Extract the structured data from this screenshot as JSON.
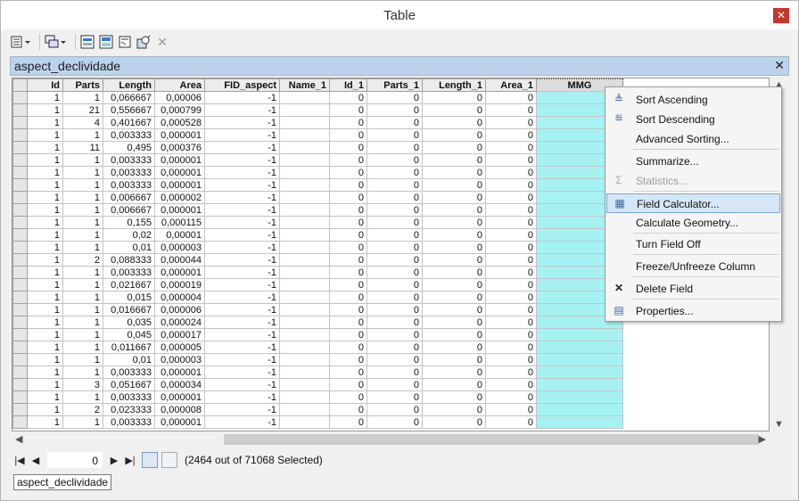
{
  "window": {
    "title": "Table",
    "close_glyph": "✕"
  },
  "toolbar": {
    "icons": [
      "table-options-icon",
      "related-tables-icon",
      "select-by-attributes-icon",
      "switch-selection-icon",
      "clear-selection-icon",
      "zoom-to-selected-icon",
      "delete-selected-icon"
    ]
  },
  "tab": {
    "title": "aspect_declividade",
    "close_glyph": "✕"
  },
  "grid": {
    "columns": [
      "Id",
      "Parts",
      "Length",
      "Area",
      "FID_aspect",
      "Name_1",
      "Id_1",
      "Parts_1",
      "Length_1",
      "Area_1",
      "MMG"
    ],
    "rows": [
      [
        "1",
        "1",
        "0,066667",
        "0,00006",
        "-1",
        "",
        "0",
        "0",
        "0",
        "0",
        ""
      ],
      [
        "1",
        "21",
        "0,556667",
        "0,000799",
        "-1",
        "",
        "0",
        "0",
        "0",
        "0",
        ""
      ],
      [
        "1",
        "4",
        "0,401667",
        "0,000528",
        "-1",
        "",
        "0",
        "0",
        "0",
        "0",
        ""
      ],
      [
        "1",
        "1",
        "0,003333",
        "0,000001",
        "-1",
        "",
        "0",
        "0",
        "0",
        "0",
        ""
      ],
      [
        "1",
        "11",
        "0,495",
        "0,000376",
        "-1",
        "",
        "0",
        "0",
        "0",
        "0",
        ""
      ],
      [
        "1",
        "1",
        "0,003333",
        "0,000001",
        "-1",
        "",
        "0",
        "0",
        "0",
        "0",
        ""
      ],
      [
        "1",
        "1",
        "0,003333",
        "0,000001",
        "-1",
        "",
        "0",
        "0",
        "0",
        "0",
        ""
      ],
      [
        "1",
        "1",
        "0,003333",
        "0,000001",
        "-1",
        "",
        "0",
        "0",
        "0",
        "0",
        ""
      ],
      [
        "1",
        "1",
        "0,006667",
        "0,000002",
        "-1",
        "",
        "0",
        "0",
        "0",
        "0",
        ""
      ],
      [
        "1",
        "1",
        "0,006667",
        "0,000001",
        "-1",
        "",
        "0",
        "0",
        "0",
        "0",
        ""
      ],
      [
        "1",
        "1",
        "0,155",
        "0,000115",
        "-1",
        "",
        "0",
        "0",
        "0",
        "0",
        ""
      ],
      [
        "1",
        "1",
        "0,02",
        "0,00001",
        "-1",
        "",
        "0",
        "0",
        "0",
        "0",
        ""
      ],
      [
        "1",
        "1",
        "0,01",
        "0,000003",
        "-1",
        "",
        "0",
        "0",
        "0",
        "0",
        ""
      ],
      [
        "1",
        "2",
        "0,088333",
        "0,000044",
        "-1",
        "",
        "0",
        "0",
        "0",
        "0",
        ""
      ],
      [
        "1",
        "1",
        "0,003333",
        "0,000001",
        "-1",
        "",
        "0",
        "0",
        "0",
        "0",
        ""
      ],
      [
        "1",
        "1",
        "0,021667",
        "0,000019",
        "-1",
        "",
        "0",
        "0",
        "0",
        "0",
        ""
      ],
      [
        "1",
        "1",
        "0,015",
        "0,000004",
        "-1",
        "",
        "0",
        "0",
        "0",
        "0",
        ""
      ],
      [
        "1",
        "1",
        "0,016667",
        "0,000006",
        "-1",
        "",
        "0",
        "0",
        "0",
        "0",
        ""
      ],
      [
        "1",
        "1",
        "0,035",
        "0,000024",
        "-1",
        "",
        "0",
        "0",
        "0",
        "0",
        ""
      ],
      [
        "1",
        "1",
        "0,045",
        "0,000017",
        "-1",
        "",
        "0",
        "0",
        "0",
        "0",
        ""
      ],
      [
        "1",
        "1",
        "0,011667",
        "0,000005",
        "-1",
        "",
        "0",
        "0",
        "0",
        "0",
        ""
      ],
      [
        "1",
        "1",
        "0,01",
        "0,000003",
        "-1",
        "",
        "0",
        "0",
        "0",
        "0",
        ""
      ],
      [
        "1",
        "1",
        "0,003333",
        "0,000001",
        "-1",
        "",
        "0",
        "0",
        "0",
        "0",
        ""
      ],
      [
        "1",
        "3",
        "0,051667",
        "0,000034",
        "-1",
        "",
        "0",
        "0",
        "0",
        "0",
        ""
      ],
      [
        "1",
        "1",
        "0,003333",
        "0,000001",
        "-1",
        "",
        "0",
        "0",
        "0",
        "0",
        ""
      ],
      [
        "1",
        "2",
        "0,023333",
        "0,000008",
        "-1",
        "",
        "0",
        "0",
        "0",
        "0",
        ""
      ],
      [
        "1",
        "1",
        "0,003333",
        "0,000001",
        "-1",
        "",
        "0",
        "0",
        "0",
        "0",
        ""
      ]
    ],
    "mmg_color": "#a6f2f2"
  },
  "context_menu": {
    "items": [
      {
        "label": "Sort Ascending",
        "icon": "sort-ascending-icon",
        "glyph": "≜",
        "disabled": false
      },
      {
        "label": "Sort Descending",
        "icon": "sort-descending-icon",
        "glyph": "≝",
        "disabled": false
      },
      {
        "label": "Advanced Sorting...",
        "icon": "",
        "glyph": "",
        "disabled": false
      },
      {
        "label": "Summarize...",
        "icon": "",
        "glyph": "",
        "disabled": false
      },
      {
        "label": "Statistics...",
        "icon": "sigma-icon",
        "glyph": "Σ",
        "disabled": true
      },
      {
        "label": "Field Calculator...",
        "icon": "calculator-icon",
        "glyph": "▦",
        "disabled": false
      },
      {
        "label": "Calculate Geometry...",
        "icon": "",
        "glyph": "",
        "disabled": false
      },
      {
        "label": "Turn Field Off",
        "icon": "",
        "glyph": "",
        "disabled": false
      },
      {
        "label": "Freeze/Unfreeze Column",
        "icon": "",
        "glyph": "",
        "disabled": false
      },
      {
        "label": "Delete Field",
        "icon": "delete-icon",
        "glyph": "✕",
        "disabled": false
      },
      {
        "label": "Properties...",
        "icon": "properties-icon",
        "glyph": "▤",
        "disabled": false
      }
    ]
  },
  "navigation": {
    "record_value": "0",
    "status": "(2464 out of 71068 Selected)"
  },
  "bottom_tab": {
    "label": "aspect_declividade"
  }
}
